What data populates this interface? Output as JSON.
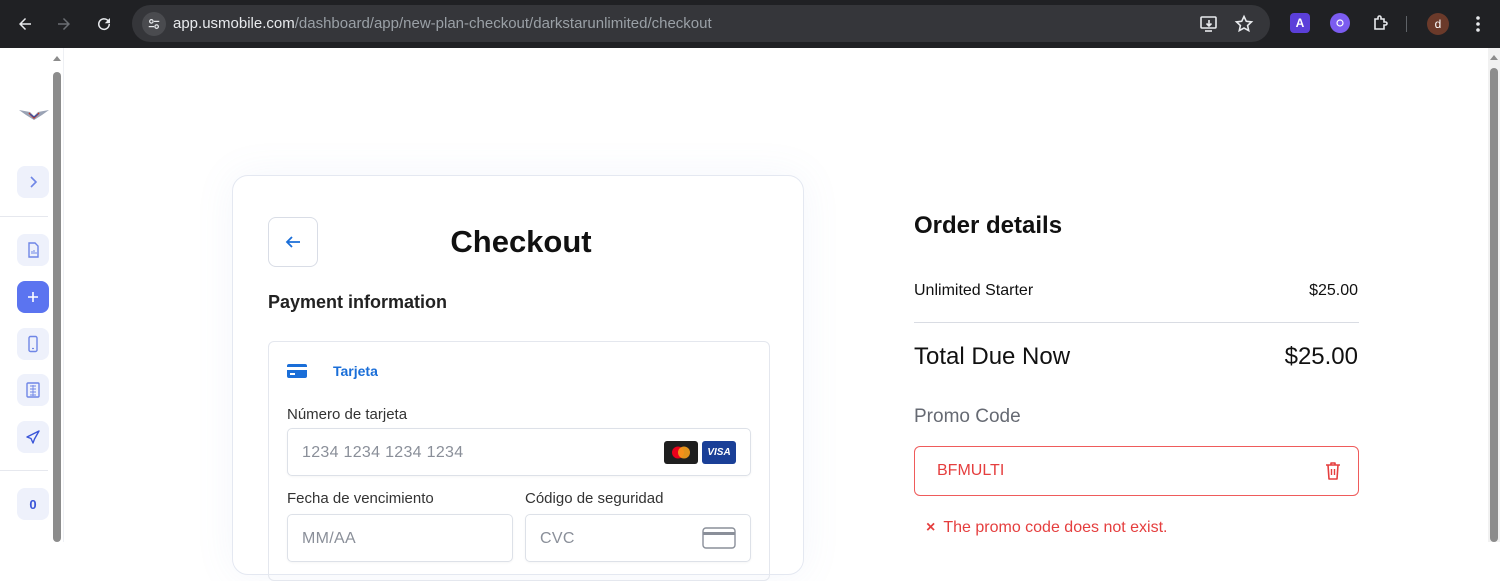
{
  "browser": {
    "url_host": "app.usmobile.com",
    "url_path": "/dashboard/app/new-plan-checkout/darkstarunlimited/checkout",
    "profile_initial": "d",
    "extension_a_label": "A"
  },
  "sidebar": {
    "count_badge": "0"
  },
  "checkout": {
    "title": "Checkout",
    "payment_heading": "Payment information",
    "tab_label": "Tarjeta",
    "card_number_label": "Número de tarjeta",
    "card_number_placeholder": "1234 1234 1234 1234",
    "expiry_label": "Fecha de vencimiento",
    "expiry_placeholder": "MM/AA",
    "cvc_label": "Código de seguridad",
    "cvc_placeholder": "CVC",
    "visa_label": "VISA"
  },
  "order": {
    "title": "Order details",
    "item_name": "Unlimited Starter",
    "item_price": "$25.00",
    "total_label": "Total Due Now",
    "total_value": "$25.00",
    "promo_label": "Promo Code",
    "promo_value": "BFMULTI",
    "promo_error_icon": "×",
    "promo_error": "The promo code does not exist."
  },
  "colors": {
    "accent": "#1a6ed8",
    "sidebar_active": "#5b74f0",
    "error": "#e53e3e"
  }
}
